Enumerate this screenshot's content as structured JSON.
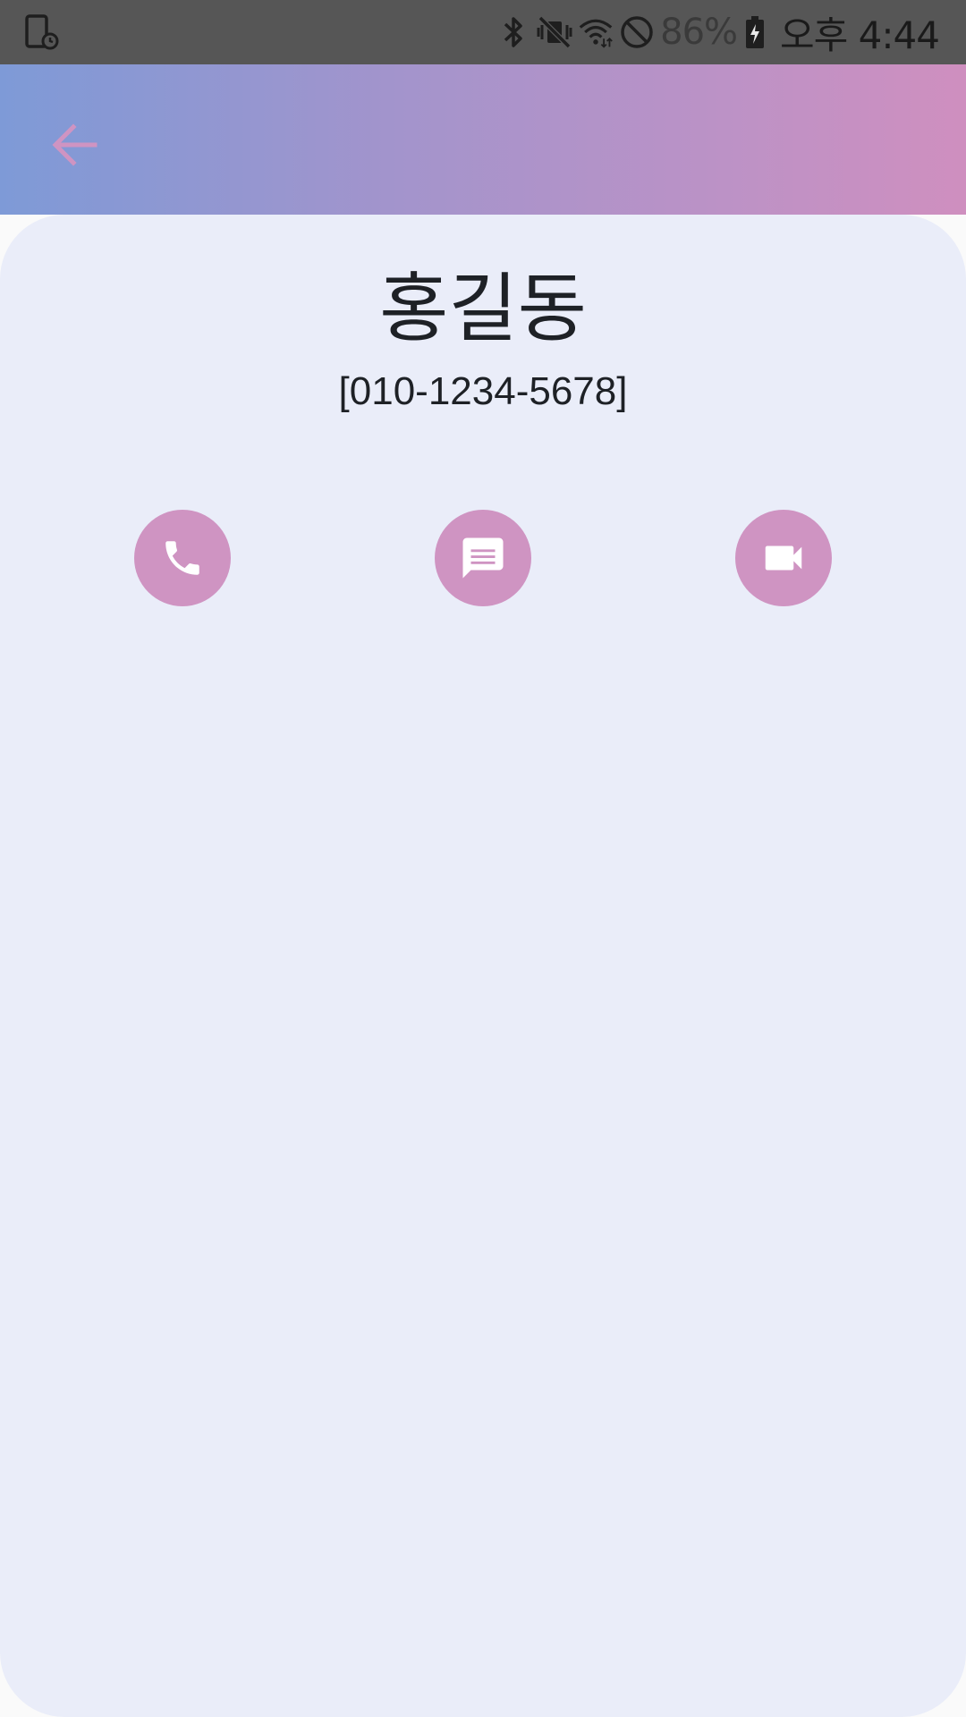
{
  "status_bar": {
    "battery_percent": "86%",
    "time": "오후 4:44",
    "icons": [
      "screen-timer-icon",
      "bluetooth-icon",
      "vibrate-mute-icon",
      "wifi-icon",
      "do-not-disturb-icon",
      "battery-charging-icon"
    ]
  },
  "app_bar": {
    "back_icon": "arrow-left-icon",
    "gradient": [
      "#7e9ad7",
      "#cf8fbf"
    ],
    "back_color": "#cf94c2"
  },
  "contact": {
    "name": "홍길동",
    "phone": "[010-1234-5678]"
  },
  "actions": [
    {
      "name": "call",
      "icon": "phone-icon"
    },
    {
      "name": "message",
      "icon": "message-icon"
    },
    {
      "name": "video",
      "icon": "videocam-icon"
    }
  ],
  "colors": {
    "accent": "#cf94c2",
    "card_background": "#eaedf9",
    "text": "#1e2126"
  }
}
